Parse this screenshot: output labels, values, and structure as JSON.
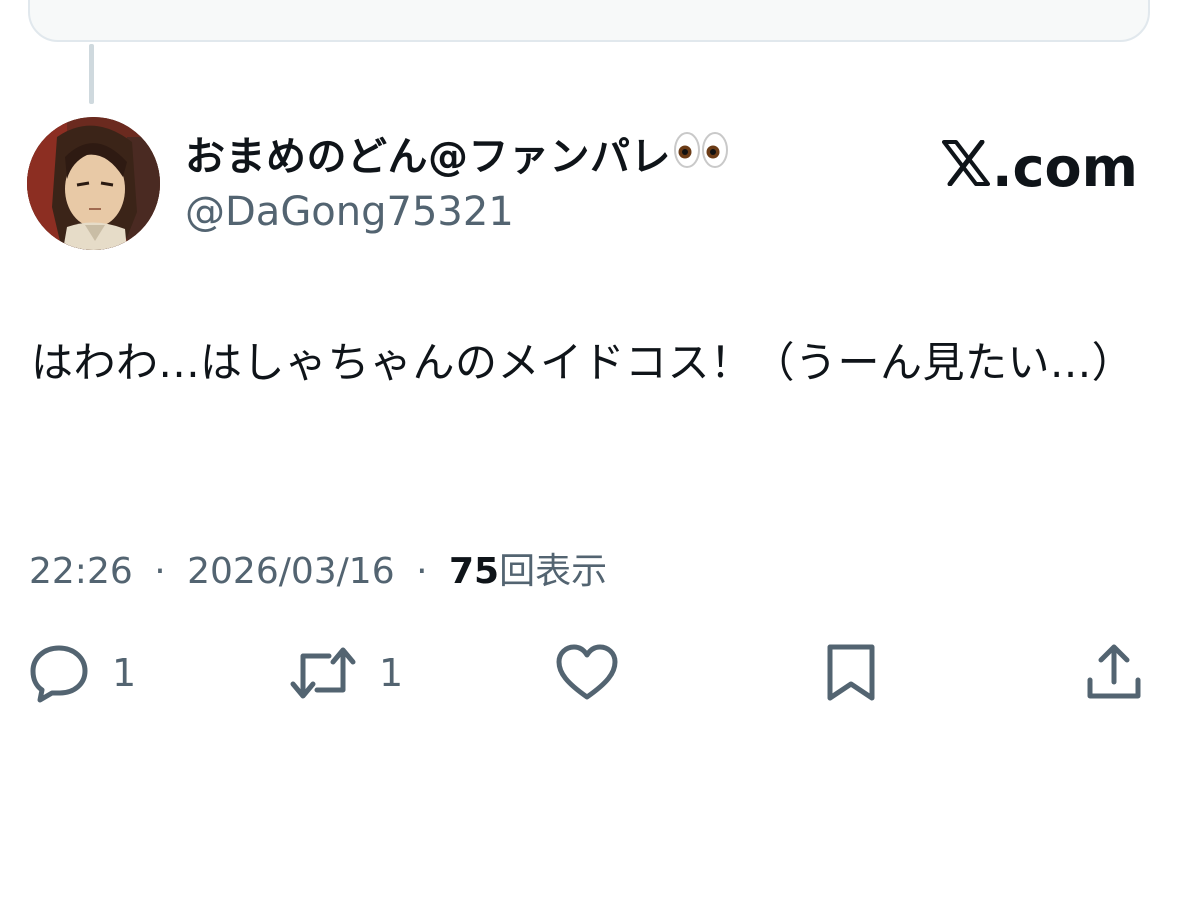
{
  "tweet": {
    "display_name": "おまめのどん@ファンパレ",
    "display_name_emoji": "eyes-icon",
    "handle": "@DaGong75321",
    "brand": ".com",
    "brand_icon": "x-logo-icon",
    "text": "はわわ...はしゃちゃんのメイドコス！（うーん見たい...）",
    "time": "22:26",
    "separator": "·",
    "date": "2026/03/16",
    "views_count": "75",
    "views_label": "回表示"
  },
  "actions": {
    "reply_count": "1",
    "retweet_count": "1",
    "icons": [
      "reply-icon",
      "retweet-icon",
      "like-icon",
      "bookmark-icon",
      "share-icon"
    ]
  },
  "colors": {
    "text": "#0f1419",
    "secondary": "#536471",
    "border": "#e1e8ed",
    "thread_line": "#cfd9de"
  }
}
